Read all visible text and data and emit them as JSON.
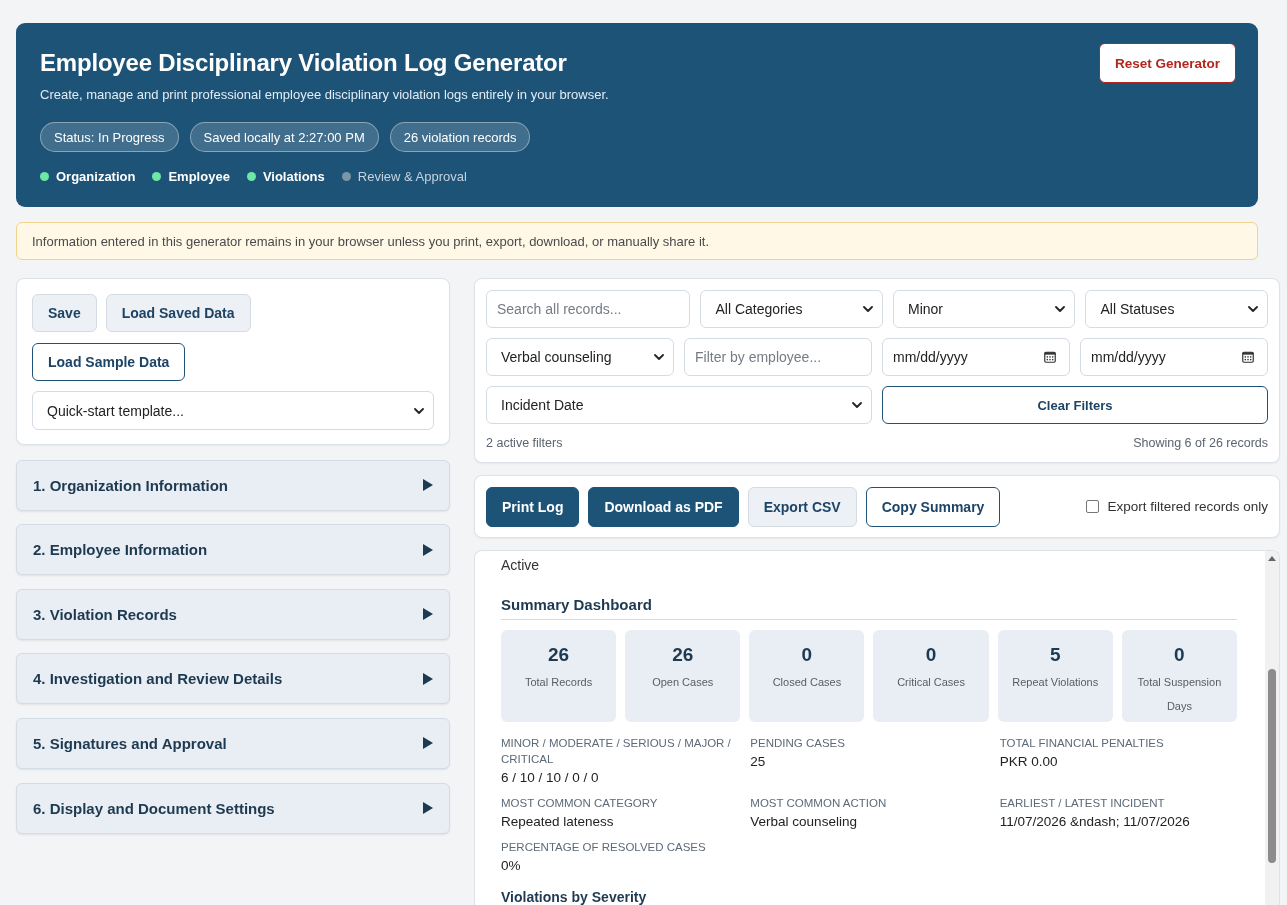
{
  "header": {
    "title": "Employee Disciplinary Violation Log Generator",
    "subtitle": "Create, manage and print professional employee disciplinary violation logs entirely in your browser.",
    "reset_button": "Reset Generator",
    "badges": [
      "Status: In Progress",
      "Saved locally at 2:27:00 PM",
      "26 violation records"
    ],
    "steps": [
      {
        "label": "Organization",
        "done": true
      },
      {
        "label": "Employee",
        "done": true
      },
      {
        "label": "Violations",
        "done": true
      },
      {
        "label": "Review & Approval",
        "done": false
      }
    ]
  },
  "notice": "Information entered in this generator remains in your browser unless you print, export, download, or manually share it.",
  "data_panel": {
    "buttons": [
      {
        "label": "Save",
        "kind": "secondary"
      },
      {
        "label": "Load Saved Data",
        "kind": "secondary"
      },
      {
        "label": "Load Sample Data",
        "kind": "outline"
      }
    ],
    "template_select": {
      "value": "Quick-start template..."
    }
  },
  "sections": [
    {
      "title": "1. Organization Information",
      "expanded": false
    },
    {
      "title": "2. Employee Information",
      "expanded": false
    },
    {
      "title": "3. Violation Records",
      "expanded": false
    },
    {
      "title": "4. Investigation and Review Details",
      "expanded": false
    },
    {
      "title": "5. Signatures and Approval",
      "expanded": false
    },
    {
      "title": "6. Display and Document Settings",
      "expanded": false
    }
  ],
  "filters": {
    "rows": [
      [
        {
          "kind": "input",
          "placeholder": "Search all records..."
        },
        {
          "kind": "select",
          "value": "All Categories"
        },
        {
          "kind": "select",
          "value": "Minor"
        },
        {
          "kind": "select",
          "value": "All Statuses"
        }
      ],
      [
        {
          "kind": "select",
          "value": "Verbal counseling"
        },
        {
          "kind": "input",
          "placeholder": "Filter by employee..."
        },
        {
          "kind": "date",
          "placeholder": "mm/dd/yyyy"
        },
        {
          "kind": "date",
          "placeholder": "mm/dd/yyyy"
        }
      ],
      [
        {
          "kind": "select",
          "value": "Incident Date"
        },
        {
          "kind": "button",
          "label": "Clear Filters"
        }
      ]
    ],
    "active_count": "2 active filters",
    "showing": "Showing 6 of 26 records"
  },
  "actions": {
    "buttons": [
      {
        "label": "Print Log",
        "kind": "primary"
      },
      {
        "label": "Download as PDF",
        "kind": "primary"
      },
      {
        "label": "Export CSV",
        "kind": "secondary"
      },
      {
        "label": "Copy Summary",
        "kind": "outline"
      }
    ],
    "export_filtered_only": {
      "label": "Export filtered records only",
      "checked": false
    }
  },
  "preview": {
    "partial_text": "Active",
    "summary_title": "Summary Dashboard",
    "stats": [
      {
        "value": "26",
        "label": "Total Records"
      },
      {
        "value": "26",
        "label": "Open Cases"
      },
      {
        "value": "0",
        "label": "Closed Cases"
      },
      {
        "value": "0",
        "label": "Critical Cases"
      },
      {
        "value": "5",
        "label": "Repeat Violations"
      },
      {
        "value": "0",
        "label": "Total Suspension Days"
      }
    ],
    "details": [
      {
        "label": "MINOR / MODERATE / SERIOUS / MAJOR / CRITICAL",
        "value": "6 / 10 / 10 / 0 / 0"
      },
      {
        "label": "PENDING CASES",
        "value": "25"
      },
      {
        "label": "TOTAL FINANCIAL PENALTIES",
        "value": "PKR 0.00"
      },
      {
        "label": "MOST COMMON CATEGORY",
        "value": "Repeated lateness"
      },
      {
        "label": "MOST COMMON ACTION",
        "value": "Verbal counseling"
      },
      {
        "label": "EARLIEST / LATEST INCIDENT",
        "value": "11/07/2026 &ndash; 11/07/2026"
      },
      {
        "label": "PERCENTAGE OF RESOLVED CASES",
        "value": "0%"
      }
    ],
    "next_heading": "Violations by Severity"
  }
}
